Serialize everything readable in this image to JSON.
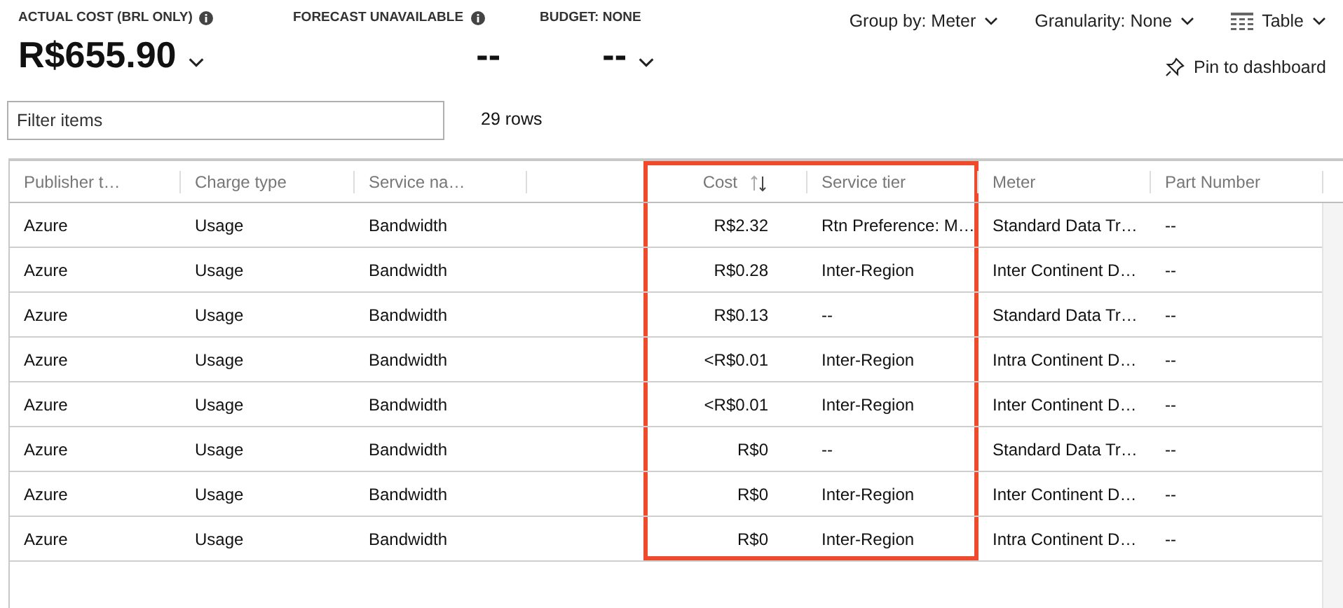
{
  "summary": [
    {
      "label": "ACTUAL COST (BRL ONLY)",
      "value": "R$655.90",
      "info": true,
      "dropdown": true
    },
    {
      "label": "FORECAST UNAVAILABLE",
      "value": "--",
      "info": true,
      "dropdown": false
    },
    {
      "label": "BUDGET: NONE",
      "value": "--",
      "info": false,
      "dropdown": true
    }
  ],
  "toolbar": [
    {
      "label": "Group by: Meter",
      "kind": "dropdown"
    },
    {
      "label": "Granularity: None",
      "kind": "dropdown"
    },
    {
      "label": "Table",
      "kind": "view"
    }
  ],
  "pin": {
    "label": "Pin to dashboard"
  },
  "filter": {
    "placeholder": "Filter items"
  },
  "row_count": "29 rows",
  "table": {
    "columns": [
      {
        "label": "Publisher t…",
        "kind": "text",
        "highlighted": false,
        "sortable": false
      },
      {
        "label": "Charge type",
        "kind": "text",
        "highlighted": false,
        "sortable": false
      },
      {
        "label": "Service na…",
        "kind": "text",
        "highlighted": false,
        "sortable": false
      },
      {
        "kind": "text",
        "highlighted": false,
        "sortable": false
      },
      {
        "label": "Cost",
        "kind": "number",
        "highlighted": true,
        "sortable": true
      },
      {
        "label": "Service tier",
        "kind": "text",
        "highlighted": true,
        "sortable": false
      },
      {
        "label": "Meter",
        "kind": "text",
        "highlighted": false,
        "sortable": false
      },
      {
        "label": "Part Number",
        "kind": "text",
        "highlighted": false,
        "sortable": false
      }
    ],
    "rows": [
      [
        "Azure",
        "Usage",
        "Bandwidth",
        "",
        "R$2.32",
        "Rtn Preference: M…",
        "Standard Data Tr…",
        "--"
      ],
      [
        "Azure",
        "Usage",
        "Bandwidth",
        "",
        "R$0.28",
        "Inter-Region",
        "Inter Continent D…",
        "--"
      ],
      [
        "Azure",
        "Usage",
        "Bandwidth",
        "",
        "R$0.13",
        "--",
        "Standard Data Tr…",
        "--"
      ],
      [
        "Azure",
        "Usage",
        "Bandwidth",
        "",
        "<R$0.01",
        "Inter-Region",
        "Intra Continent D…",
        "--"
      ],
      [
        "Azure",
        "Usage",
        "Bandwidth",
        "",
        "<R$0.01",
        "Inter-Region",
        "Inter Continent D…",
        "--"
      ],
      [
        "Azure",
        "Usage",
        "Bandwidth",
        "",
        "R$0",
        "--",
        "Standard Data Tr…",
        "--"
      ],
      [
        "Azure",
        "Usage",
        "Bandwidth",
        "",
        "R$0",
        "Inter-Region",
        "Inter Continent D…",
        "--"
      ],
      [
        "Azure",
        "Usage",
        "Bandwidth",
        "",
        "R$0",
        "Inter-Region",
        "Intra Continent D…",
        "--"
      ]
    ]
  }
}
